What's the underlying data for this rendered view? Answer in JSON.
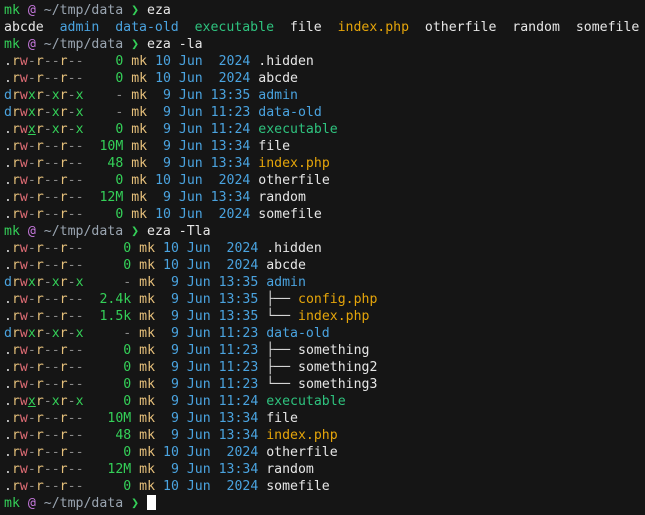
{
  "terminal": {
    "prompt": {
      "user": "mk",
      "at_glyph": "@",
      "path": "~/tmp/data",
      "arrow": "❯"
    },
    "blocks": [
      {
        "command": "eza",
        "grid": [
          {
            "name": "abcde",
            "kind": "plain"
          },
          {
            "name": "admin",
            "kind": "dir"
          },
          {
            "name": "data-old",
            "kind": "dir"
          },
          {
            "name": "executable",
            "kind": "exe"
          },
          {
            "name": "file",
            "kind": "plain"
          },
          {
            "name": "index.php",
            "kind": "php"
          },
          {
            "name": "otherfile",
            "kind": "plain"
          },
          {
            "name": "random",
            "kind": "plain"
          },
          {
            "name": "somefile",
            "kind": "plain"
          }
        ]
      },
      {
        "command": "eza -la",
        "rows": [
          {
            "perm": ".rw-r--r--",
            "size": "0",
            "user": "mk",
            "date": "10 Jun  2024",
            "name": ".hidden",
            "kind": "plain",
            "tree": ""
          },
          {
            "perm": ".rw-r--r--",
            "size": "0",
            "user": "mk",
            "date": "10 Jun  2024",
            "name": "abcde",
            "kind": "plain",
            "tree": ""
          },
          {
            "perm": "drwxr-xr-x",
            "size": "-",
            "user": "mk",
            "date": " 9 Jun 13:35",
            "name": "admin",
            "kind": "dir",
            "tree": ""
          },
          {
            "perm": "drwxr-xr-x",
            "size": "-",
            "user": "mk",
            "date": " 9 Jun 11:23",
            "name": "data-old",
            "kind": "dir",
            "tree": ""
          },
          {
            "perm": ".rwxr-xr-x",
            "size": "0",
            "user": "mk",
            "date": " 9 Jun 11:24",
            "name": "executable",
            "kind": "exe",
            "tree": ""
          },
          {
            "perm": ".rw-r--r--",
            "size": "10M",
            "user": "mk",
            "date": " 9 Jun 13:34",
            "name": "file",
            "kind": "plain",
            "tree": ""
          },
          {
            "perm": ".rw-r--r--",
            "size": "48",
            "user": "mk",
            "date": " 9 Jun 13:34",
            "name": "index.php",
            "kind": "php",
            "tree": ""
          },
          {
            "perm": ".rw-r--r--",
            "size": "0",
            "user": "mk",
            "date": "10 Jun  2024",
            "name": "otherfile",
            "kind": "plain",
            "tree": ""
          },
          {
            "perm": ".rw-r--r--",
            "size": "12M",
            "user": "mk",
            "date": " 9 Jun 13:34",
            "name": "random",
            "kind": "plain",
            "tree": ""
          },
          {
            "perm": ".rw-r--r--",
            "size": "0",
            "user": "mk",
            "date": "10 Jun  2024",
            "name": "somefile",
            "kind": "plain",
            "tree": ""
          }
        ]
      },
      {
        "command": "eza -Tla",
        "rows": [
          {
            "perm": ".rw-r--r--",
            "size": "0",
            "user": "mk",
            "date": "10 Jun  2024",
            "name": ".hidden",
            "kind": "plain",
            "tree": ""
          },
          {
            "perm": ".rw-r--r--",
            "size": "0",
            "user": "mk",
            "date": "10 Jun  2024",
            "name": "abcde",
            "kind": "plain",
            "tree": ""
          },
          {
            "perm": "drwxr-xr-x",
            "size": "-",
            "user": "mk",
            "date": " 9 Jun 13:35",
            "name": "admin",
            "kind": "dir",
            "tree": ""
          },
          {
            "perm": ".rw-r--r--",
            "size": "2.4k",
            "user": "mk",
            "date": " 9 Jun 13:35",
            "name": "config.php",
            "kind": "php",
            "tree": "├── "
          },
          {
            "perm": ".rw-r--r--",
            "size": "1.5k",
            "user": "mk",
            "date": " 9 Jun 13:35",
            "name": "index.php",
            "kind": "php",
            "tree": "└── "
          },
          {
            "perm": "drwxr-xr-x",
            "size": "-",
            "user": "mk",
            "date": " 9 Jun 11:23",
            "name": "data-old",
            "kind": "dir",
            "tree": ""
          },
          {
            "perm": ".rw-r--r--",
            "size": "0",
            "user": "mk",
            "date": " 9 Jun 11:23",
            "name": "something",
            "kind": "plain",
            "tree": "├── "
          },
          {
            "perm": ".rw-r--r--",
            "size": "0",
            "user": "mk",
            "date": " 9 Jun 11:23",
            "name": "something2",
            "kind": "plain",
            "tree": "├── "
          },
          {
            "perm": ".rw-r--r--",
            "size": "0",
            "user": "mk",
            "date": " 9 Jun 11:23",
            "name": "something3",
            "kind": "plain",
            "tree": "└── "
          },
          {
            "perm": ".rwxr-xr-x",
            "size": "0",
            "user": "mk",
            "date": " 9 Jun 11:24",
            "name": "executable",
            "kind": "exe",
            "tree": ""
          },
          {
            "perm": ".rw-r--r--",
            "size": "10M",
            "user": "mk",
            "date": " 9 Jun 13:34",
            "name": "file",
            "kind": "plain",
            "tree": ""
          },
          {
            "perm": ".rw-r--r--",
            "size": "48",
            "user": "mk",
            "date": " 9 Jun 13:34",
            "name": "index.php",
            "kind": "php",
            "tree": ""
          },
          {
            "perm": ".rw-r--r--",
            "size": "0",
            "user": "mk",
            "date": "10 Jun  2024",
            "name": "otherfile",
            "kind": "plain",
            "tree": ""
          },
          {
            "perm": ".rw-r--r--",
            "size": "12M",
            "user": "mk",
            "date": " 9 Jun 13:34",
            "name": "random",
            "kind": "plain",
            "tree": ""
          },
          {
            "perm": ".rw-r--r--",
            "size": "0",
            "user": "mk",
            "date": "10 Jun  2024",
            "name": "somefile",
            "kind": "plain",
            "tree": ""
          }
        ]
      }
    ],
    "final_prompt_input": ""
  }
}
